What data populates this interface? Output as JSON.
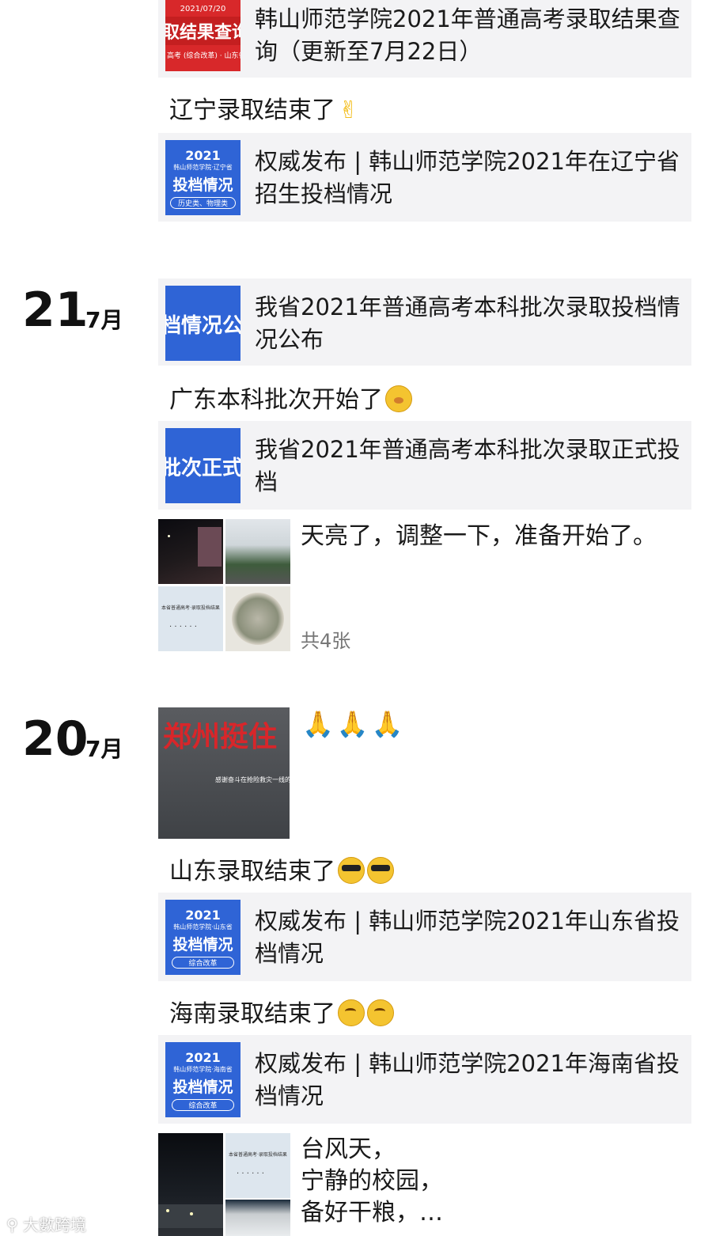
{
  "posts": {
    "card_result": {
      "thumb_date": "2021/07/20",
      "thumb_title": "取结果查询",
      "thumb_sub": "高考 (综合改革) · 山东省",
      "text": "韩山师范学院2021年普通高考录取结果查询（更新至7月22日）"
    },
    "liaoning_caption": "辽宁录取结束了",
    "card_liaoning": {
      "thumb_year": "2021",
      "thumb_line": "韩山师范学院·辽宁省",
      "thumb_title": "投档情况",
      "thumb_tag": "历史类、物理类",
      "text": "权威发布 | 韩山师范学院2021年在辽宁省招生投档情况"
    },
    "date21": {
      "day": "21",
      "month": "7月"
    },
    "card_undergrad1": {
      "thumb_title": "档情况公",
      "text": "我省2021年普通高考本科批次录取投档情况公布"
    },
    "guangdong_caption": "广东本科批次开始了",
    "card_undergrad2": {
      "thumb_title": "批次正式",
      "text": "我省2021年普通高考本科批次录取正式投档"
    },
    "dawn_post": {
      "text": "天亮了，调整一下，准备开始了。",
      "count": "共4张",
      "thumb_doc_line": "本省普通高考·录取投档结果",
      "thumb_dots": "· · · · · ·"
    },
    "date20": {
      "day": "20",
      "month": "7月"
    },
    "zhengzhou_post": {
      "thumb_title": "郑州挺住",
      "thumb_sub": "感谢奋斗在抢险救灾一线的"
    },
    "shandong_caption": "山东录取结束了",
    "card_shandong": {
      "thumb_year": "2021",
      "thumb_line": "韩山师范学院·山东省",
      "thumb_title": "投档情况",
      "thumb_tag": "综合改革",
      "text": "权威发布 | 韩山师范学院2021年山东省投档情况"
    },
    "hainan_caption": "海南录取结束了",
    "card_hainan": {
      "thumb_year": "2021",
      "thumb_line": "韩山师范学院·海南省",
      "thumb_title": "投档情况",
      "thumb_tag": "综合改革",
      "text": "权威发布 | 韩山师范学院2021年海南省投档情况"
    },
    "typhoon_post": {
      "line1": "台风天，",
      "line2": "宁静的校园，",
      "line3": "备好干粮，…",
      "thumb_doc_line": "本省普通高考·录取投档结果",
      "thumb_dots": "· · · · · ·"
    }
  },
  "watermark": "大數跨境",
  "colors": {
    "card_bg": "#f3f3f5",
    "blue": "#2f64d6",
    "red": "#d8282a"
  }
}
